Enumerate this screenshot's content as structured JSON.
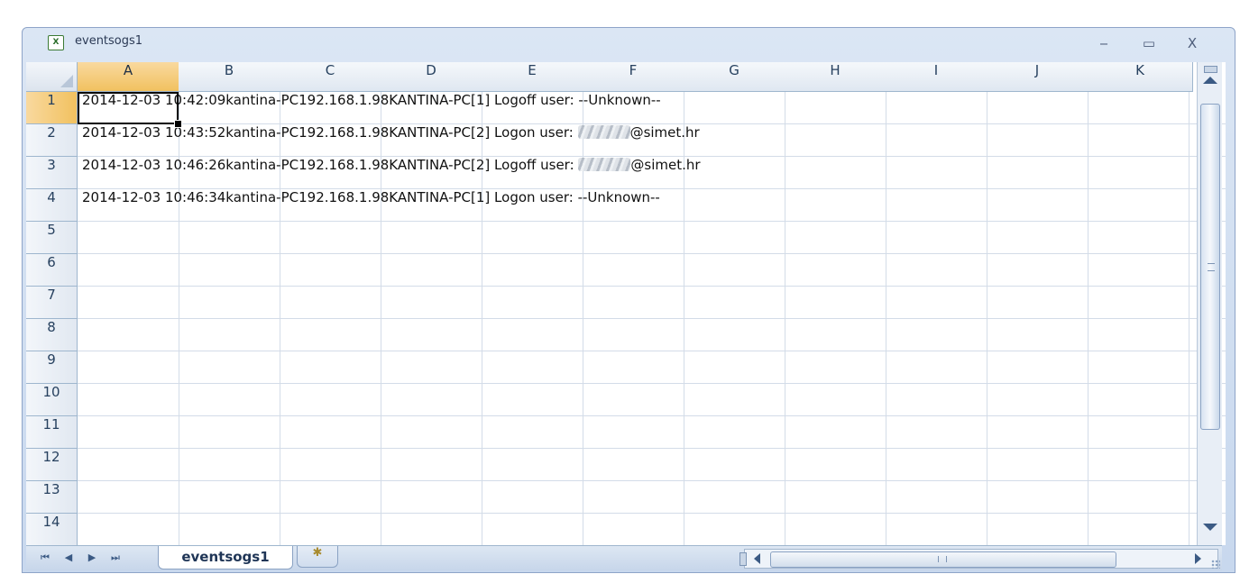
{
  "window": {
    "title": "eventsogs1",
    "icon": "excel-icon",
    "controls": {
      "minimize": "‒",
      "maximize": "▭",
      "close": "X"
    }
  },
  "sheet": {
    "columns": [
      "A",
      "B",
      "C",
      "D",
      "E",
      "F",
      "G",
      "H",
      "I",
      "J",
      "K"
    ],
    "rows": [
      "1",
      "2",
      "3",
      "4",
      "5",
      "6",
      "7",
      "8",
      "9",
      "10",
      "11",
      "12",
      "13",
      "14"
    ],
    "selected_cell": "A1",
    "cells": [
      {
        "row": "1",
        "parts": [
          "2014-12-03 10:42:09kantina-PC192.168.1.98KANTINA-PC[1] Logoff user: --Unknown--"
        ]
      },
      {
        "row": "2",
        "parts": [
          "2014-12-03 10:43:52kantina-PC192.168.1.98KANTINA-PC[2] Logon user: ",
          "@simet.hr"
        ],
        "redacted": true
      },
      {
        "row": "3",
        "parts": [
          "2014-12-03 10:46:26kantina-PC192.168.1.98KANTINA-PC[2] Logoff user: ",
          "@simet.hr"
        ],
        "redacted": true
      },
      {
        "row": "4",
        "parts": [
          "2014-12-03 10:46:34kantina-PC192.168.1.98KANTINA-PC[1] Logon user: --Unknown--"
        ]
      }
    ]
  },
  "tabs": {
    "nav": [
      "⏮",
      "◀",
      "▶",
      "⏭"
    ],
    "active": "eventsogs1",
    "new_sheet_icon": "insert-sheet-icon"
  }
}
